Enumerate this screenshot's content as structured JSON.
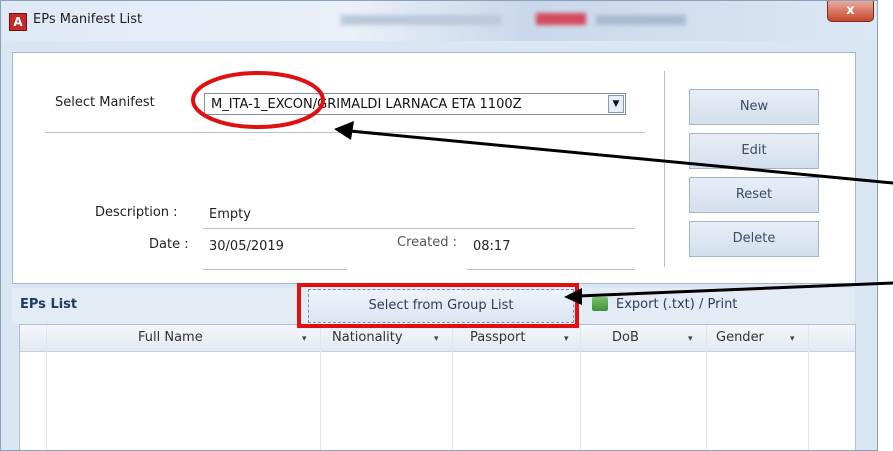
{
  "window": {
    "title": "EPs Manifest List",
    "app_icon_letter": "A",
    "close_glyph": "x"
  },
  "manifest": {
    "select_label": "Select Manifest",
    "value": "M_ITA-1_EXCON/GRIMALDI LARNACA ETA 1100Z",
    "description_label": "Description :",
    "description_value": "Empty",
    "date_label": "Date :",
    "date_value": "30/05/2019",
    "created_label": "Created :",
    "created_value": "08:17"
  },
  "side_buttons": {
    "new": "New",
    "edit": "Edit",
    "reset": "Reset",
    "delete": "Delete"
  },
  "eps": {
    "title": "EPs List",
    "group_button": "Select from Group List",
    "export": "Export (.txt) / Print",
    "columns": [
      "Full Name",
      "Nationality",
      "Passport",
      "DoB",
      "Gender"
    ]
  },
  "colors": {
    "highlight_red": "#e01010",
    "accent_blue": "#1e3a66"
  }
}
